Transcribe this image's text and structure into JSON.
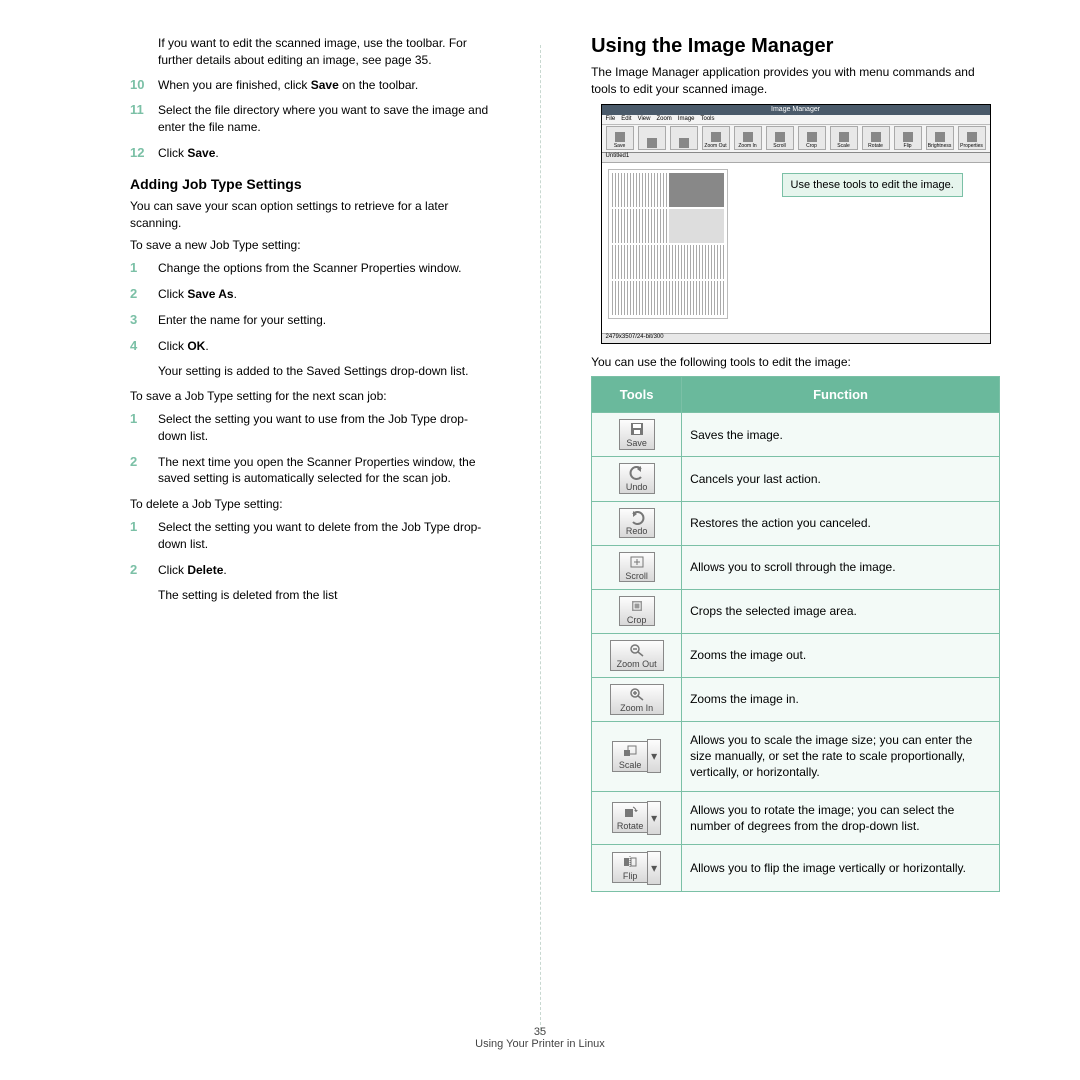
{
  "left": {
    "intro1": "If you want to edit the scanned image, use the toolbar. For further details about editing an image, see page 35.",
    "step10_n": "10",
    "step10_a": "When you are finished, click ",
    "step10_b": "Save",
    "step10_c": " on the toolbar.",
    "step11_n": "11",
    "step11": "Select the file directory where you want to save the image and enter the file name.",
    "step12_n": "12",
    "step12_a": "Click ",
    "step12_b": "Save",
    "step12_c": ".",
    "h2": "Adding Job Type Settings",
    "p1": "You can save your scan option settings to retrieve for a later scanning.",
    "p2": "To save a new Job Type setting:",
    "s1_n": "1",
    "s1": "Change the options from the Scanner Properties window.",
    "s2_n": "2",
    "s2_a": "Click ",
    "s2_b": "Save As",
    "s2_c": ".",
    "s3_n": "3",
    "s3": "Enter the name for your setting.",
    "s4_n": "4",
    "s4_a": "Click ",
    "s4_b": "OK",
    "s4_c": ".",
    "s4_sub": "Your setting is added to the Saved Settings drop-down list.",
    "p3": "To save a Job Type setting for the next scan job:",
    "t1_n": "1",
    "t1": "Select the setting you want to use from the Job Type drop-down list.",
    "t2_n": "2",
    "t2": "The next time you open the Scanner Properties window, the saved setting is automatically selected for the scan job.",
    "p4": "To delete a Job Type setting:",
    "d1_n": "1",
    "d1": "Select the setting you want to delete from the Job Type drop-down list.",
    "d2_n": "2",
    "d2_a": "Click ",
    "d2_b": "Delete",
    "d2_c": ".",
    "d2_sub": "The setting is deleted from the list"
  },
  "right": {
    "h1": "Using the Image Manager",
    "intro": "The Image Manager application provides you with menu commands and tools to edit your scanned image.",
    "callout": "Use these tools to edit the image.",
    "ss": {
      "title": "Image Manager",
      "menus": [
        "File",
        "Edit",
        "View",
        "Zoom",
        "Image",
        "Tools"
      ],
      "toolbar": [
        "Save",
        "",
        "",
        "Zoom Out",
        "Zoom In",
        "Scroll",
        "Crop",
        "Scale",
        "Rotate",
        "Flip",
        "Brightness",
        "",
        "Properties"
      ],
      "tab": "Untitled1",
      "status": "2479x3507/24-bit/300"
    },
    "table_intro": "You can use the following tools to edit the image:",
    "th_tools": "Tools",
    "th_func": "Function",
    "rows": [
      {
        "label": "Save",
        "wide": false,
        "drop": false,
        "func": "Saves the image."
      },
      {
        "label": "Undo",
        "wide": false,
        "drop": false,
        "func": "Cancels your last action."
      },
      {
        "label": "Redo",
        "wide": false,
        "drop": false,
        "func": "Restores the action you canceled."
      },
      {
        "label": "Scroll",
        "wide": false,
        "drop": false,
        "func": "Allows you to scroll through the image."
      },
      {
        "label": "Crop",
        "wide": false,
        "drop": false,
        "func": "Crops the selected image area."
      },
      {
        "label": "Zoom Out",
        "wide": true,
        "drop": false,
        "func": "Zooms the image out."
      },
      {
        "label": "Zoom In",
        "wide": true,
        "drop": false,
        "func": "Zooms the image in."
      },
      {
        "label": "Scale",
        "wide": false,
        "drop": true,
        "func": "Allows you to scale the image size; you can enter the size manually, or set the rate to scale proportionally, vertically, or horizontally."
      },
      {
        "label": "Rotate",
        "wide": false,
        "drop": true,
        "func": "Allows you to rotate the image; you can select the number of degrees from the drop-down list."
      },
      {
        "label": "Flip",
        "wide": false,
        "drop": true,
        "func": "Allows you to flip the image vertically or horizontally."
      }
    ]
  },
  "footer": {
    "page": "35",
    "section": "Using Your Printer in Linux"
  }
}
